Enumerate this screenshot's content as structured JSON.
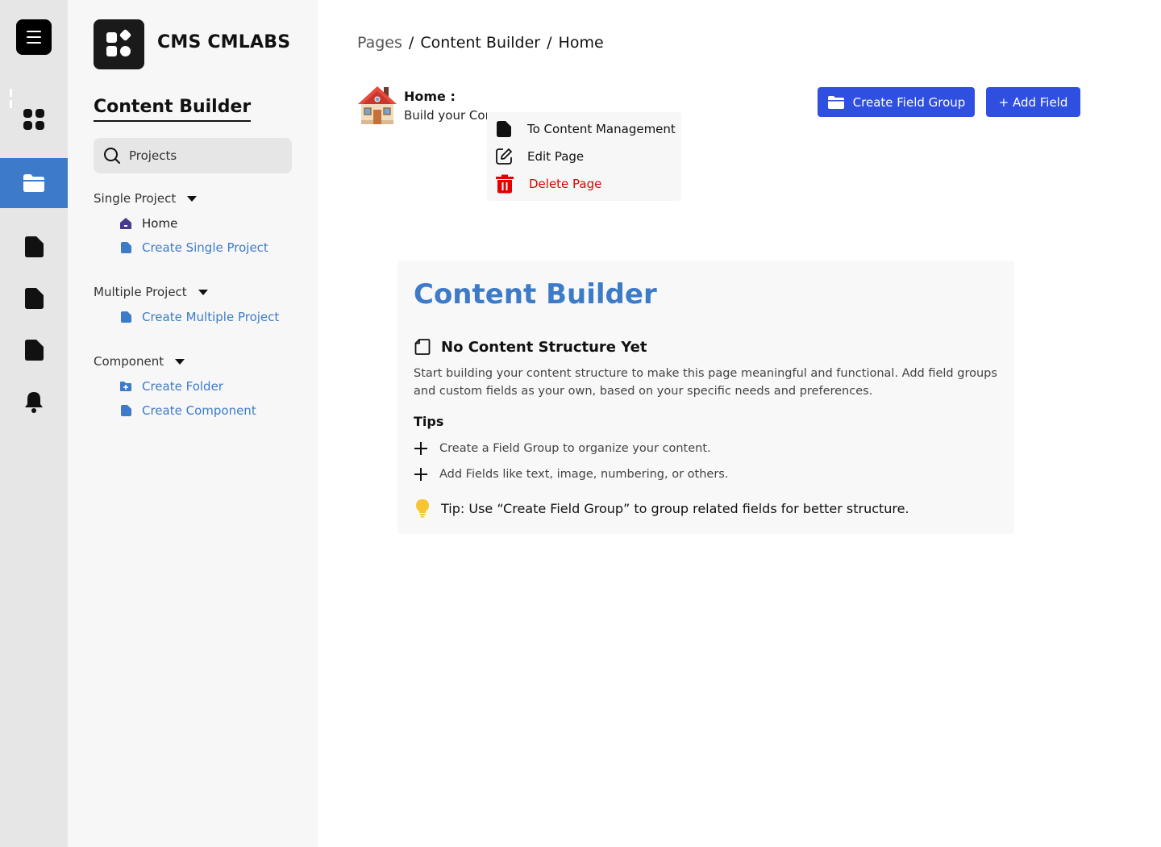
{
  "rail": {
    "icons": [
      "menu-icon",
      "dashboard-grid-icon",
      "folder-icon",
      "file-icon",
      "file-icon",
      "file-icon",
      "bell-icon"
    ],
    "active": "folder-icon"
  },
  "sidebar": {
    "brand": "CMS CMLABS",
    "section_title": "Content Builder",
    "search_label": "Projects",
    "groups": [
      {
        "label": "Single Project",
        "items": [
          {
            "label": "Home",
            "icon": "home-icon"
          },
          {
            "label": "Create Single Project",
            "icon": "file-icon"
          }
        ]
      },
      {
        "label": "Multiple Project",
        "items": [
          {
            "label": "Create Multiple Project",
            "icon": "file-icon"
          }
        ]
      },
      {
        "label": "Component",
        "items": [
          {
            "label": "Create Folder",
            "icon": "folder-plus-icon"
          },
          {
            "label": "Create Component",
            "icon": "file-icon"
          }
        ]
      }
    ]
  },
  "breadcrumb": {
    "items": [
      "Pages",
      "Content Builder",
      "Home"
    ],
    "separator": "/"
  },
  "page_header": {
    "title": "Home :",
    "subtitle": "Build your Content"
  },
  "actions": {
    "create_field_group": "Create Field Group",
    "add_field": "+ Add Field"
  },
  "dropdown": {
    "items": [
      {
        "label": "To Content Management",
        "icon": "file-icon"
      },
      {
        "label": "Edit Page",
        "icon": "edit-icon"
      },
      {
        "label": "Delete Page",
        "icon": "trash-icon",
        "danger": true
      }
    ]
  },
  "card": {
    "title": "Content Builder",
    "empty_title": "No Content Structure Yet",
    "empty_desc": "Start building your content structure to make this page meaningful and functional. Add field groups and custom fields as your own, based on your specific needs and preferences.",
    "tips_heading": "Tips",
    "tips": [
      "Create a Field Group to organize your content.",
      "Add Fields like text, image, numbering, or others."
    ],
    "tip_note": "Tip: Use “Create Field Group” to group related fields for better structure."
  },
  "colors": {
    "accent_blue": "#3d7bc9",
    "button_blue": "#2f4fe0",
    "danger": "#e20000",
    "rail_bg": "#e6e6e6",
    "sidebar_bg": "#f7f7f7"
  }
}
